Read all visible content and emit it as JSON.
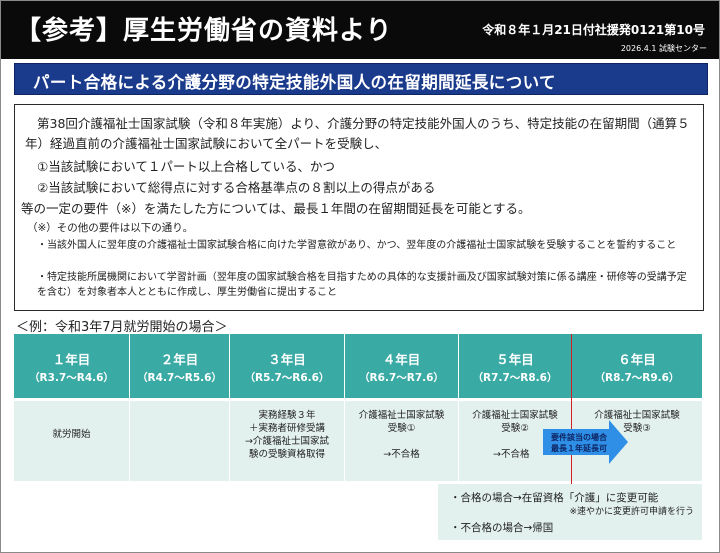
{
  "header": {
    "title": "【参考】厚生労働省の資料より",
    "reference": "令和８年１月21日付社援発0121第10号",
    "date_source": "2026.4.1 試験センター"
  },
  "banner": {
    "text": "パート合格による介護分野の特定技能外国人の在留期間延長について"
  },
  "box": {
    "intro": "第38回介護福祉士国家試験（令和８年実施）より、介護分野の特定技能外国人のうち、特定技能の在留期間（通算５年）経過直前の介護福祉士国家試験において全パートを受験し、",
    "cond1": "①当該試験において１パート以上合格している、かつ",
    "cond2": "②当該試験において総得点に対する合格基準点の８割以上の得点がある",
    "summary": "等の一定の要件（※）を満たした方については、最長１年間の在留期間延長を可能とする。",
    "other_title": "（※）その他の要件は以下の通り。",
    "bullet1": "・当該外国人に翌年度の介護福祉士国家試験合格に向けた学習意欲があり、かつ、翌年度の介護福祉士国家試験を受験することを誓約すること",
    "bullet2": "・特定技能所属機関において学習計画（翌年度の国家試験合格を目指すための具体的な支援計画及び国家試験対策に係る講座・研修等の受講予定を含む）を対象者本人とともに作成し、厚生労働省に提出すること"
  },
  "example": {
    "title": "＜例：令和3年7月就労開始の場合＞",
    "years": [
      {
        "year": "１年目",
        "range": "（R3.7〜R4.6）",
        "l1": "",
        "l2": "就労開始",
        "l3": "",
        "l4": ""
      },
      {
        "year": "２年目",
        "range": "（R4.7〜R5.6）",
        "l1": "",
        "l2": "",
        "l3": "",
        "l4": ""
      },
      {
        "year": "３年目",
        "range": "（R5.7〜R6.6）",
        "l1": "実務経験３年",
        "l2": "＋実務者研修受講",
        "l3": "→介護福祉士国家試",
        "l4": "験の受験資格取得"
      },
      {
        "year": "４年目",
        "range": "（R6.7〜R7.6）",
        "l1": "介護福祉士国家試験",
        "l2": "受験①",
        "l3": "",
        "l4": "→不合格"
      },
      {
        "year": "５年目",
        "range": "（R7.7〜R8.6）",
        "l1": "介護福祉士国家試験",
        "l2": "受験②",
        "l3": "",
        "l4": "→不合格"
      },
      {
        "year": "６年目",
        "range": "（R8.7〜R9.6）",
        "l1": "介護福祉士国家試験",
        "l2": "受験③",
        "l3": "",
        "l4": ""
      }
    ],
    "arrow_line1": "要件該当の場合",
    "arrow_line2": "最長１年延長可",
    "note_pass": "・合格の場合→在留資格「介護」に変更可能",
    "note_pass_sub": "※速やかに変更許可申請を行う",
    "note_fail": "・不合格の場合→帰国"
  },
  "colors": {
    "header_bg": "#0a0a0a",
    "banner_bg": "#1a3a8c",
    "teal": "#3aaaa5",
    "light_teal": "#e3f1ee",
    "arrow": "#2f8fe6",
    "red_line": "#d32020"
  }
}
